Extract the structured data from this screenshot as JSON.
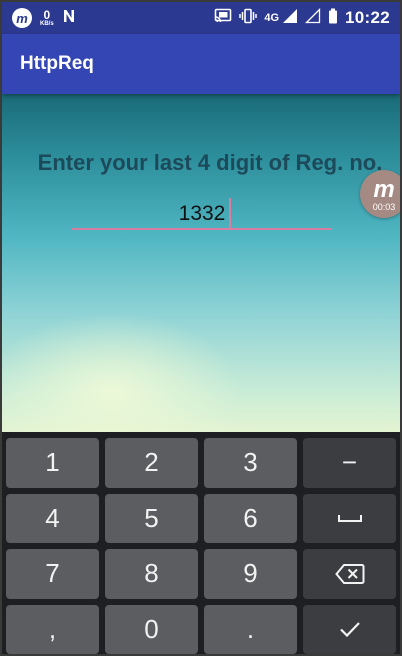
{
  "status_bar": {
    "speed_value": "0",
    "speed_unit": "KB/s",
    "network_type": "4G",
    "time": "10:22"
  },
  "app_bar": {
    "title": "HttpReq"
  },
  "form": {
    "prompt": "Enter your last 4 digit of Reg. no.",
    "input_value": "1332",
    "underline_color": "#d67fa0"
  },
  "recorder_bubble": {
    "letter": "m",
    "elapsed": "00:03"
  },
  "keyboard": {
    "keys": [
      "1",
      "2",
      "3",
      "−",
      "4",
      "5",
      "6",
      "space",
      "7",
      "8",
      "9",
      "backspace",
      ",",
      "0",
      ".",
      "done"
    ],
    "labels": {
      "k1": "1",
      "k2": "2",
      "k3": "3",
      "minus": "−",
      "k4": "4",
      "k5": "5",
      "k6": "6",
      "k7": "7",
      "k8": "8",
      "k9": "9",
      "comma": ",",
      "k0": "0",
      "period": "."
    }
  },
  "colors": {
    "status_bar": "#2c3990",
    "app_bar": "#3446b3",
    "keyboard_bg": "#1d1f22",
    "key_bg": "#5b5d60",
    "fn_key_bg": "#3b3d40"
  }
}
